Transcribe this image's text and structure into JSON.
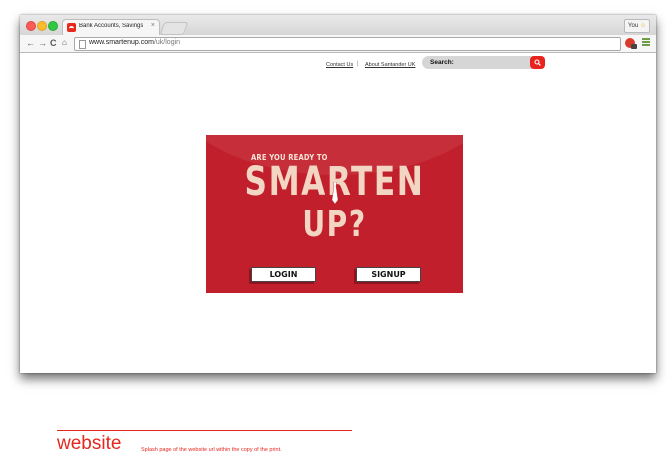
{
  "browser": {
    "tab_title": "Bank Accounts, Savings, L",
    "tab_close": "×",
    "user_label": "You",
    "url_host": "www.smartenup.com",
    "url_path": "/uk/login",
    "nav": {
      "back": "←",
      "forward": "→",
      "reload": "C",
      "home": "⌂"
    }
  },
  "page": {
    "links": {
      "contact": "Contact Us",
      "separator": "|",
      "about": "About Santander UK"
    },
    "search": {
      "label": "Search:"
    },
    "splash": {
      "kicker": "ARE YOU READY TO",
      "headline_1": "SMARTEN",
      "headline_2": "UP?",
      "login": "LOGIN",
      "signup": "SIGNUP"
    }
  },
  "caption": {
    "title": "website",
    "description": "Splash page of the website url within the copy of the print."
  },
  "colors": {
    "brand_red": "#e4281e",
    "splash_red": "#c21f2c",
    "splash_text": "#f2d6c3"
  }
}
